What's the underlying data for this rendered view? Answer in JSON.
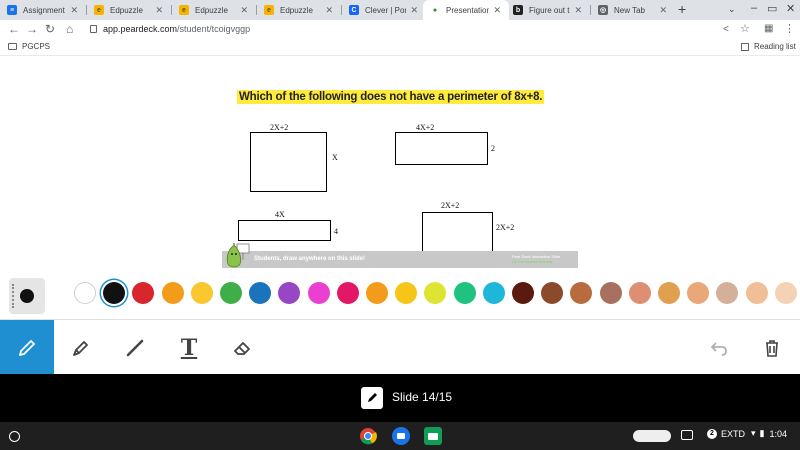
{
  "tabs": [
    {
      "title": "Assignment d",
      "favicon_color": "#1a73e8",
      "favicon_glyph": "≡"
    },
    {
      "title": "Edpuzzle",
      "favicon_color": "#f5b400",
      "favicon_glyph": "e"
    },
    {
      "title": "Edpuzzle",
      "favicon_color": "#f5b400",
      "favicon_glyph": "e"
    },
    {
      "title": "Edpuzzle",
      "favicon_color": "#f5b400",
      "favicon_glyph": "e"
    },
    {
      "title": "Clever | Portal",
      "favicon_color": "#1464ff",
      "favicon_glyph": "C"
    },
    {
      "title": "Presentation S",
      "favicon_color": "#7ed957",
      "favicon_glyph": "♠"
    },
    {
      "title": "Figure out the",
      "favicon_color": "#222222",
      "favicon_glyph": "b"
    },
    {
      "title": "New Tab",
      "favicon_color": "#5f6368",
      "favicon_glyph": "◎"
    }
  ],
  "browser": {
    "url_domain": "app.peardeck.com",
    "url_path": "/student/tcoigvggp",
    "bookmark": "PGCPS",
    "reading_list": "Reading list"
  },
  "slide": {
    "question": "Which of the following does not have a perimeter of 8x+8.",
    "shapes": [
      {
        "top_label": "2X+2",
        "side_label": "X"
      },
      {
        "top_label": "4X+2",
        "side_label": "2"
      },
      {
        "top_label": "4X",
        "side_label": "4"
      },
      {
        "top_label": "2X+2",
        "side_label": "2X+2"
      }
    ],
    "footer_text": "Students, draw anywhere on this slide!",
    "brand_line1": "Pear Deck Interactive Slide",
    "brand_line2": "Do not remove this bar"
  },
  "palette": {
    "selected": "#111111",
    "colors": [
      "#ffffff",
      "#111111",
      "#d9262c",
      "#f39c1b",
      "#f9c72f",
      "#3fae49",
      "#1b73bb",
      "#9747c6",
      "#ea3fd1",
      "#e21867",
      "#f39c1b",
      "#f5c518",
      "#dfe332",
      "#1fc27f",
      "#1eb6d9",
      "#5b1a0e",
      "#8b4a2b",
      "#b86b3d",
      "#a87060",
      "#de8f73",
      "#e0a050",
      "#e8a877",
      "#d4b09b",
      "#f0bf95",
      "#f4d2b5"
    ]
  },
  "tools": [
    "pen-tool",
    "highlighter-tool",
    "line-tool",
    "text-tool",
    "eraser-tool"
  ],
  "slide_nav": {
    "label": "Slide 14/15"
  },
  "shelf": {
    "status_number": "2",
    "ime": "EXTD",
    "time": "1:04"
  }
}
